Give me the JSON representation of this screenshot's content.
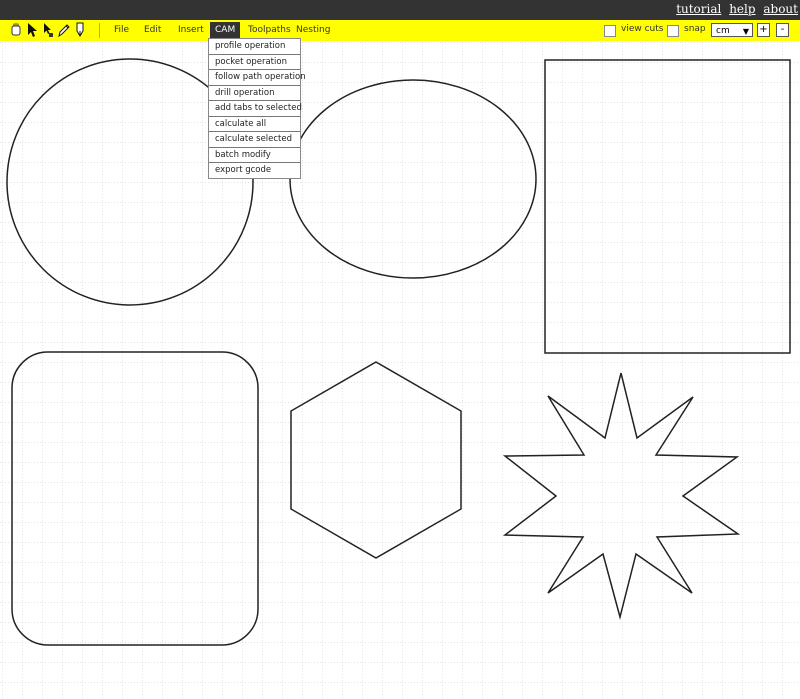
{
  "top_links": [
    "tutorial",
    "help",
    "about"
  ],
  "tools": [
    {
      "name": "select-icon"
    },
    {
      "name": "pointer-icon"
    },
    {
      "name": "node-edit-icon"
    },
    {
      "name": "pencil-icon"
    },
    {
      "name": "pen-icon"
    }
  ],
  "menus": [
    "File",
    "Edit",
    "Insert",
    "CAM",
    "Toolpaths",
    "Nesting"
  ],
  "active_menu": "CAM",
  "cam_menu_items": [
    "profile operation",
    "pocket operation",
    "follow path operation",
    "drill operation",
    "add tabs to selected",
    "calculate all",
    "calculate selected",
    "batch modify",
    "export gcode"
  ],
  "options": {
    "view_cuts_label": "view cuts",
    "view_cuts_checked": false,
    "snap_label": "snap",
    "snap_checked": false
  },
  "units": {
    "selected": "cm"
  },
  "zoom": {
    "in_label": "+",
    "out_label": "-"
  },
  "colors": {
    "toolbar_bg": "#ffff00",
    "topbar_bg": "#333333",
    "menu_active_bg": "#333333",
    "grid": "#c8c8c8",
    "shape_stroke": "#222222"
  },
  "shapes": [
    "circle",
    "ellipse",
    "square",
    "rounded-rectangle",
    "hexagon",
    "star"
  ]
}
